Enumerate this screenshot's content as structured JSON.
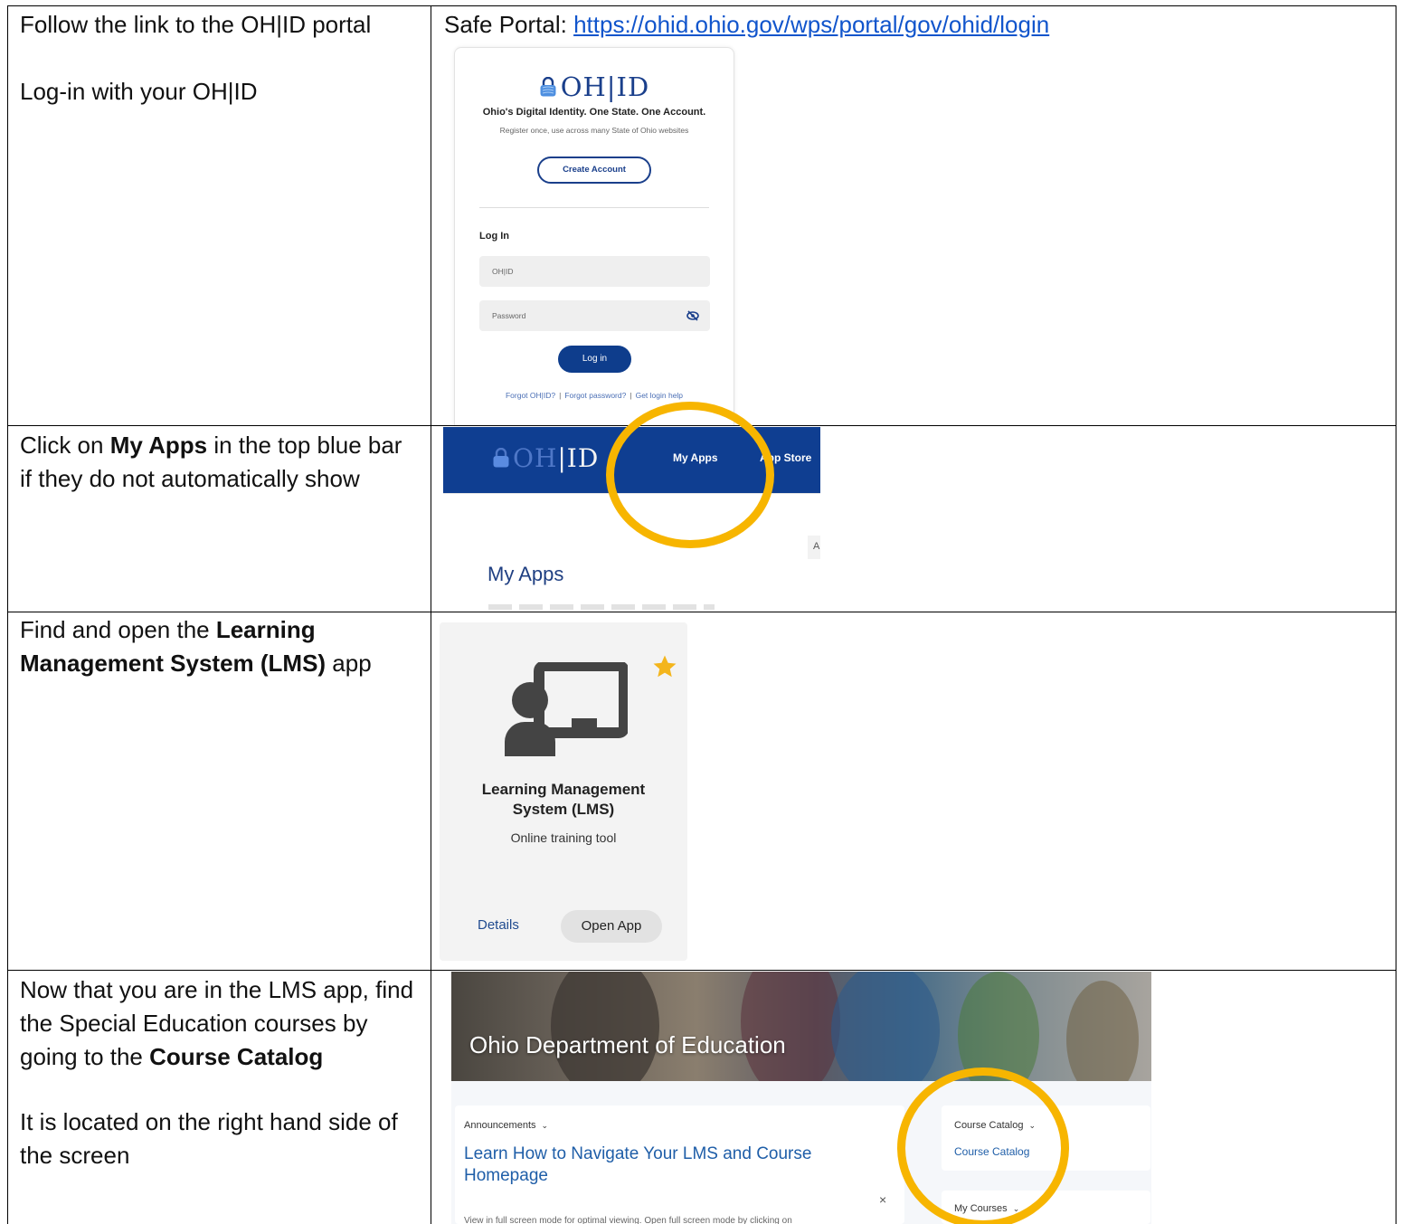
{
  "rows": [
    {
      "instruction_lines": [
        "Follow the link to the OH|ID portal",
        "Log-in with your OH|ID"
      ]
    },
    {
      "instruction_pre": "Click on ",
      "instruction_bold": "My Apps",
      "instruction_post": " in the top blue bar if they do not automatically show"
    },
    {
      "instruction_pre": "Find and open the ",
      "instruction_bold": "Learning Management System (LMS)",
      "instruction_post": " app"
    },
    {
      "instruction_pre": "Now that you are in the LMS app, find the Special Education courses by going to the ",
      "instruction_bold": "Course Catalog",
      "instruction_post": "",
      "instruction_2": "It is located on the right hand side of the screen"
    }
  ],
  "safe_portal": {
    "label": "Safe Portal: ",
    "url": "https://ohid.ohio.gov/wps/portal/gov/ohid/login"
  },
  "login_card": {
    "logo_text": "OH|ID",
    "tagline": "Ohio's Digital Identity. One State. One Account.",
    "subtitle": "Register once, use across many State of Ohio websites",
    "create_account": "Create Account",
    "login_heading": "Log In",
    "ohid_placeholder": "OH|ID",
    "password_placeholder": "Password",
    "login_button": "Log in",
    "forgot_ohid": "Forgot OH|ID?",
    "forgot_password": "Forgot password?",
    "login_help": "Get login help",
    "separator": "|"
  },
  "topbar": {
    "logo_oh": "OH",
    "logo_id": "|ID",
    "my_apps": "My Apps",
    "app_store": "App Store",
    "cut_letter": "A",
    "page_title": "My Apps"
  },
  "app_card": {
    "title": "Learning Management System (LMS)",
    "description": "Online training tool",
    "details": "Details",
    "open_app": "Open App"
  },
  "lms": {
    "banner_title": "Ohio Department of Education",
    "announcements": "Announcements",
    "announcement_title": "Learn How to Navigate Your LMS and Course Homepage",
    "close": "×",
    "announcement_text": "View in full screen mode for optimal viewing. Open full screen mode by clicking on",
    "course_catalog_heading": "Course Catalog",
    "course_catalog_link": "Course Catalog",
    "my_courses": "My Courses"
  },
  "colors": {
    "ohid_blue": "#0f3e91",
    "highlight_circle": "#f7b500",
    "link_blue": "#1155cc"
  }
}
